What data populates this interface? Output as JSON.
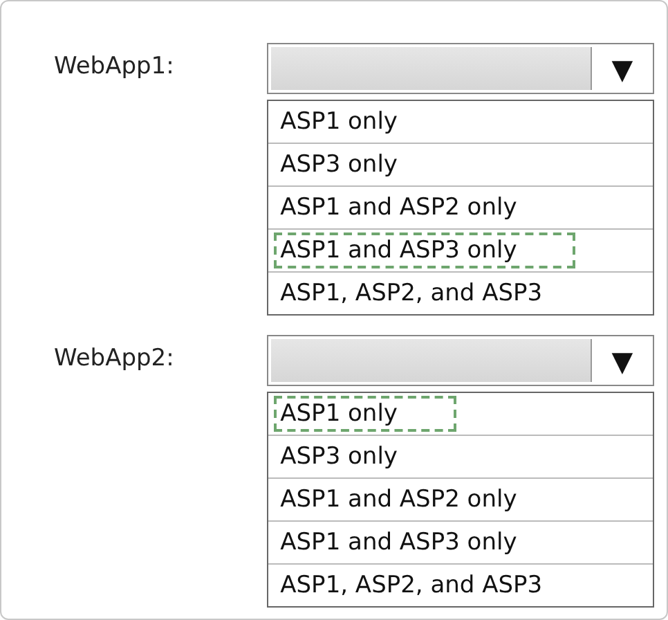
{
  "dropdowns": [
    {
      "label": "WebApp1:",
      "arrow": "▼",
      "options": [
        {
          "text": "ASP1 only",
          "selected": false
        },
        {
          "text": "ASP3 only",
          "selected": false
        },
        {
          "text": "ASP1 and ASP2 only",
          "selected": false
        },
        {
          "text": "ASP1 and ASP3 only",
          "selected": true
        },
        {
          "text": "ASP1, ASP2, and ASP3",
          "selected": false
        }
      ]
    },
    {
      "label": "WebApp2:",
      "arrow": "▼",
      "options": [
        {
          "text": "ASP1 only",
          "selected": true
        },
        {
          "text": "ASP3 only",
          "selected": false
        },
        {
          "text": "ASP1 and ASP2 only",
          "selected": false
        },
        {
          "text": "ASP1 and ASP3 only",
          "selected": false
        },
        {
          "text": "ASP1, ASP2, and ASP3",
          "selected": false
        }
      ]
    }
  ]
}
